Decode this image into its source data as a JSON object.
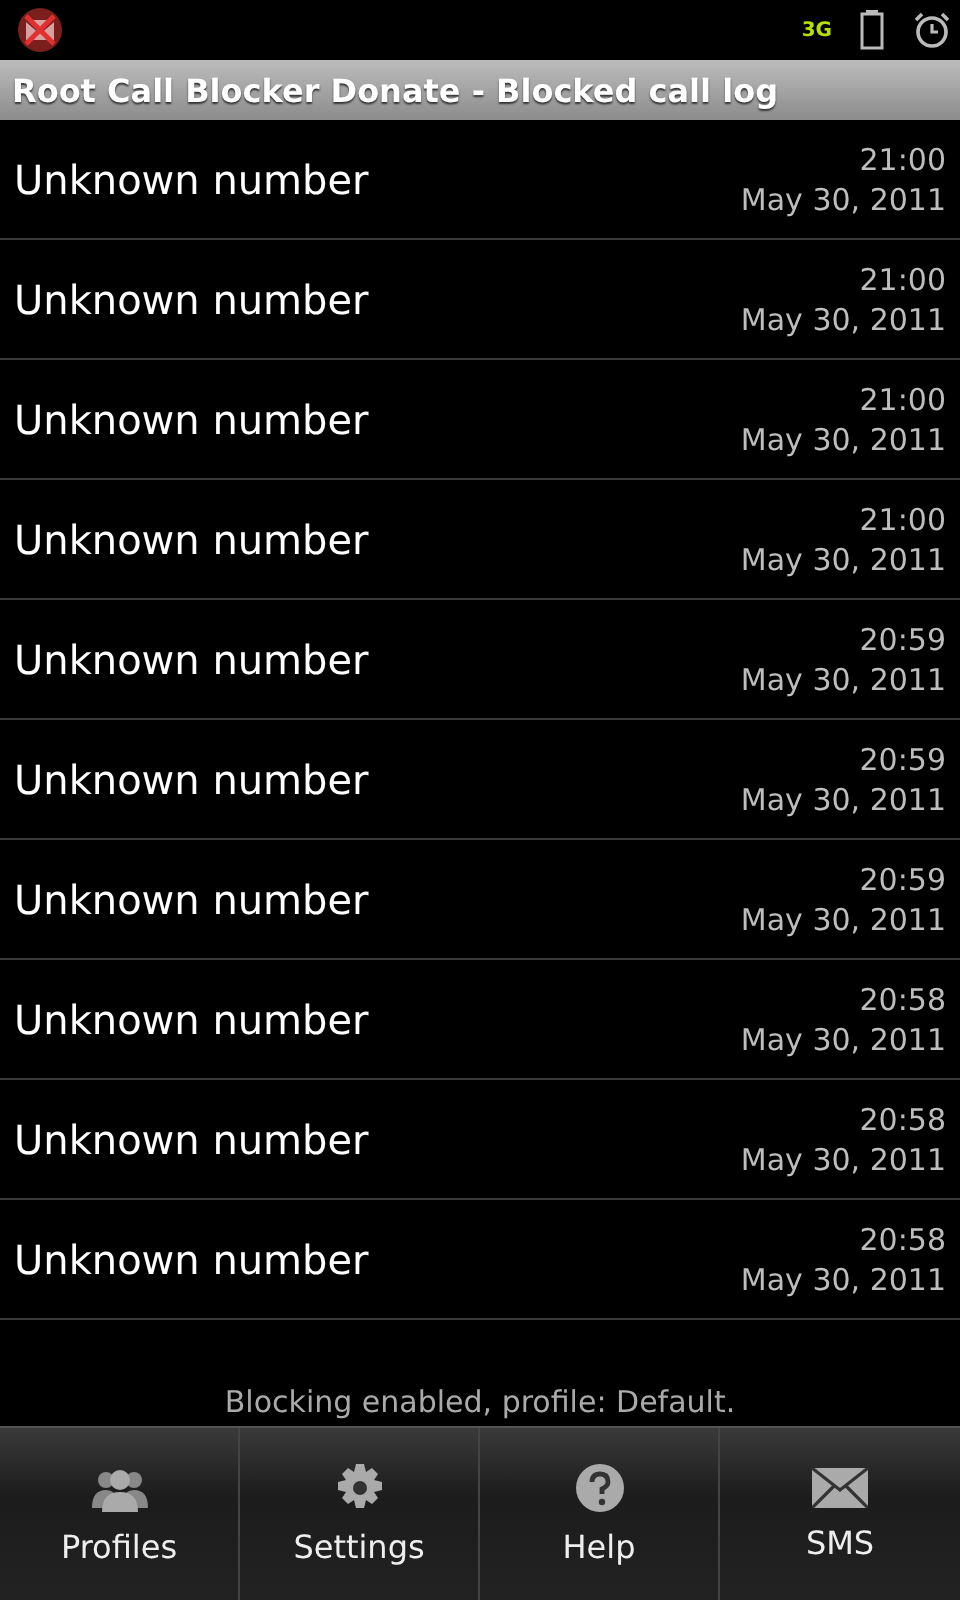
{
  "status_bar": {
    "network": "3G"
  },
  "window": {
    "title": "Root Call Blocker Donate - Blocked call log"
  },
  "calls": [
    {
      "name": "Unknown number",
      "time": "21:00",
      "date": "May 30, 2011"
    },
    {
      "name": "Unknown number",
      "time": "21:00",
      "date": "May 30, 2011"
    },
    {
      "name": "Unknown number",
      "time": "21:00",
      "date": "May 30, 2011"
    },
    {
      "name": "Unknown number",
      "time": "21:00",
      "date": "May 30, 2011"
    },
    {
      "name": "Unknown number",
      "time": "20:59",
      "date": "May 30, 2011"
    },
    {
      "name": "Unknown number",
      "time": "20:59",
      "date": "May 30, 2011"
    },
    {
      "name": "Unknown number",
      "time": "20:59",
      "date": "May 30, 2011"
    },
    {
      "name": "Unknown number",
      "time": "20:58",
      "date": "May 30, 2011"
    },
    {
      "name": "Unknown number",
      "time": "20:58",
      "date": "May 30, 2011"
    },
    {
      "name": "Unknown number",
      "time": "20:58",
      "date": "May 30, 2011"
    }
  ],
  "status_message": "Blocking enabled, profile: Default.",
  "menu": [
    {
      "label": "Profiles",
      "kind": "profiles"
    },
    {
      "label": "Settings",
      "kind": "settings"
    },
    {
      "label": "Help",
      "kind": "help"
    },
    {
      "label": "SMS",
      "kind": "sms"
    }
  ]
}
